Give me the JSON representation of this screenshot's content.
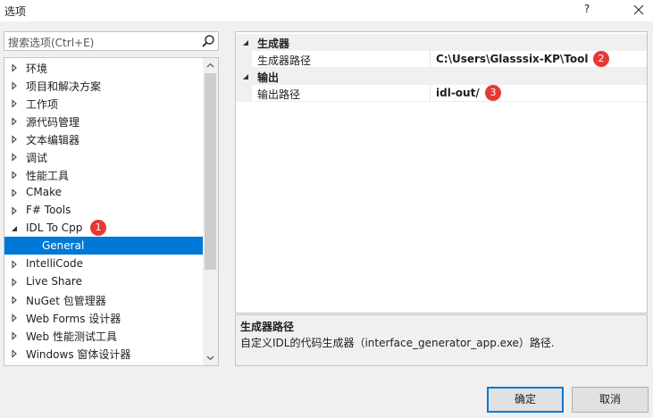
{
  "window": {
    "title": "选项",
    "help_label": "?"
  },
  "search": {
    "placeholder": "搜索选项(Ctrl+E)"
  },
  "tree": {
    "items": [
      {
        "label": "环境",
        "state": "collapsed"
      },
      {
        "label": "项目和解决方案",
        "state": "collapsed"
      },
      {
        "label": "工作项",
        "state": "collapsed"
      },
      {
        "label": "源代码管理",
        "state": "collapsed"
      },
      {
        "label": "文本编辑器",
        "state": "collapsed"
      },
      {
        "label": "调试",
        "state": "collapsed"
      },
      {
        "label": "性能工具",
        "state": "collapsed"
      },
      {
        "label": "CMake",
        "state": "collapsed"
      },
      {
        "label": "F# Tools",
        "state": "collapsed"
      },
      {
        "label": "IDL To Cpp",
        "state": "expanded",
        "badge": "1"
      },
      {
        "label": "General",
        "state": "leaf",
        "selected": true
      },
      {
        "label": "IntelliCode",
        "state": "collapsed"
      },
      {
        "label": "Live Share",
        "state": "collapsed"
      },
      {
        "label": "NuGet 包管理器",
        "state": "collapsed"
      },
      {
        "label": "Web Forms 设计器",
        "state": "collapsed"
      },
      {
        "label": "Web 性能测试工具",
        "state": "collapsed"
      },
      {
        "label": "Windows 窗体设计器",
        "state": "collapsed"
      }
    ]
  },
  "grid": {
    "categories": [
      {
        "label": "生成器",
        "props": [
          {
            "name": "生成器路径",
            "value": "C:\\Users\\Glasssix-KP\\Tool",
            "badge": "2"
          }
        ]
      },
      {
        "label": "输出",
        "props": [
          {
            "name": "输出路径",
            "value": "idl-out/",
            "badge": "3"
          }
        ]
      }
    ]
  },
  "description": {
    "title": "生成器路径",
    "text": "自定义IDL的代码生成器（interface_generator_app.exe）路径."
  },
  "buttons": {
    "ok": "确定",
    "cancel": "取消"
  },
  "colors": {
    "accent": "#0078d7",
    "badge": "#e53935"
  }
}
